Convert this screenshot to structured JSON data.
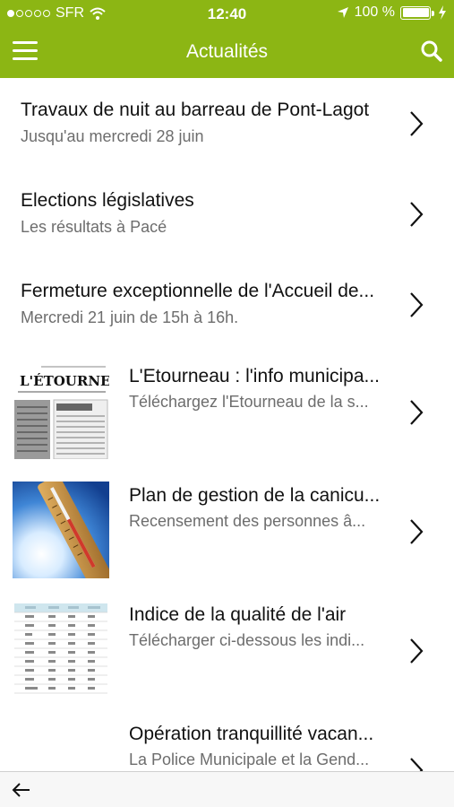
{
  "status": {
    "carrier": "SFR",
    "time": "12:40",
    "battery": "100 %"
  },
  "navbar": {
    "title": "Actualités"
  },
  "items": [
    {
      "title": "Travaux de nuit au barreau de Pont-Lagot",
      "subtitle": "Jusqu'au mercredi 28 juin"
    },
    {
      "title": "Elections législatives",
      "subtitle": "Les résultats à Pacé"
    },
    {
      "title": "Fermeture exceptionnelle de l'Accueil de...",
      "subtitle": "Mercredi 21 juin de 15h à 16h."
    },
    {
      "title": "L'Etourneau : l'info municipa...",
      "subtitle": "Téléchargez l'Etourneau de la s...",
      "thumb_text": "L'ÉTOURNEAU"
    },
    {
      "title": "Plan de gestion de la canicu...",
      "subtitle": "Recensement des personnes â..."
    },
    {
      "title": "Indice de la qualité de l'air",
      "subtitle": "Télécharger ci-dessous les indi..."
    },
    {
      "title": "Opération tranquillité vacan...",
      "subtitle": "La Police Municipale et la Gend..."
    }
  ]
}
